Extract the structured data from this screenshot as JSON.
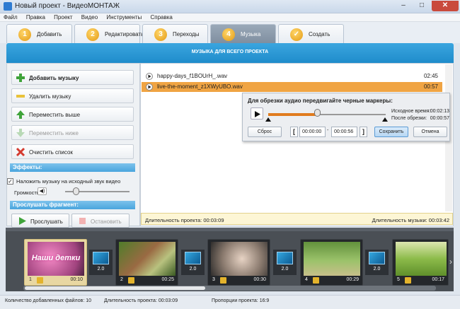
{
  "window": {
    "title": "Новый проект - ВидеоМОНТАЖ",
    "minimize": "–",
    "maximize": "□",
    "close": "✕"
  },
  "menu": [
    "Файл",
    "Правка",
    "Проект",
    "Видео",
    "Инструменты",
    "Справка"
  ],
  "tabs": [
    {
      "num": "1",
      "label": "Добавить"
    },
    {
      "num": "2",
      "label": "Редактировать"
    },
    {
      "num": "3",
      "label": "Переходы"
    },
    {
      "num": "4",
      "label": "Музыка",
      "active": true
    },
    {
      "num": "",
      "label": "Создать"
    }
  ],
  "section_title": "МУЗЫКА ДЛЯ ВСЕГО ПРОЕКТА",
  "left": {
    "add_music": "Добавить музыку",
    "delete_music": "Удалить музыку",
    "move_up": "Переместить выше",
    "move_down": "Переместить ниже",
    "clear_list": "Очистить список",
    "effects_header": "Эффекты:",
    "overlay_checkbox": "Наложить музыку на исходный звук видео",
    "overlay_checked": true,
    "volume_label": "Громкость",
    "volume_level": 0.2,
    "listen_header": "Прослушать фрагмент:",
    "play_btn": "Прослушать",
    "stop_btn": "Остановить"
  },
  "tracks": [
    {
      "name": "happy-days_f1BOUrH_.wav",
      "duration": "02:45",
      "selected": false
    },
    {
      "name": "live-the-moment_z1XWyUBO.wav",
      "duration": "00:57",
      "selected": true,
      "remove": "€"
    }
  ],
  "trim_popup": {
    "title": "Для обрезки аудио передвигайте черные маркеры:",
    "source_label": "Исходное время:",
    "source_time": "00:02:13",
    "after_label": "После обрезки:",
    "after_time": "00:00:57",
    "reset": "Сброс",
    "start": "00:00:00",
    "dash": "-",
    "end": "00:00:56",
    "save": "Сохранить",
    "cancel": "Отмена",
    "bracket_open": "[",
    "bracket_close": "]"
  },
  "duration_bar": {
    "project_label": "Длительность проекта: 00:03:09",
    "music_label": "Длительность музыки: 00:03:42"
  },
  "timeline": {
    "clips": [
      {
        "num": "1",
        "dur": "00:10",
        "thumb_text": "Наши детки",
        "selected": true
      },
      {
        "num": "2",
        "dur": "00:25"
      },
      {
        "num": "3",
        "dur": "00:30"
      },
      {
        "num": "4",
        "dur": "00:29"
      },
      {
        "num": "5",
        "dur": "00:17"
      }
    ],
    "transitions": [
      "2.0",
      "2.0",
      "2.0",
      "2.0"
    ]
  },
  "status": {
    "files": "Количество добавленных файлов: 10",
    "duration": "Длительность проекта: 00:03:09",
    "ratio": "Пропорции проекта: 16:9"
  }
}
